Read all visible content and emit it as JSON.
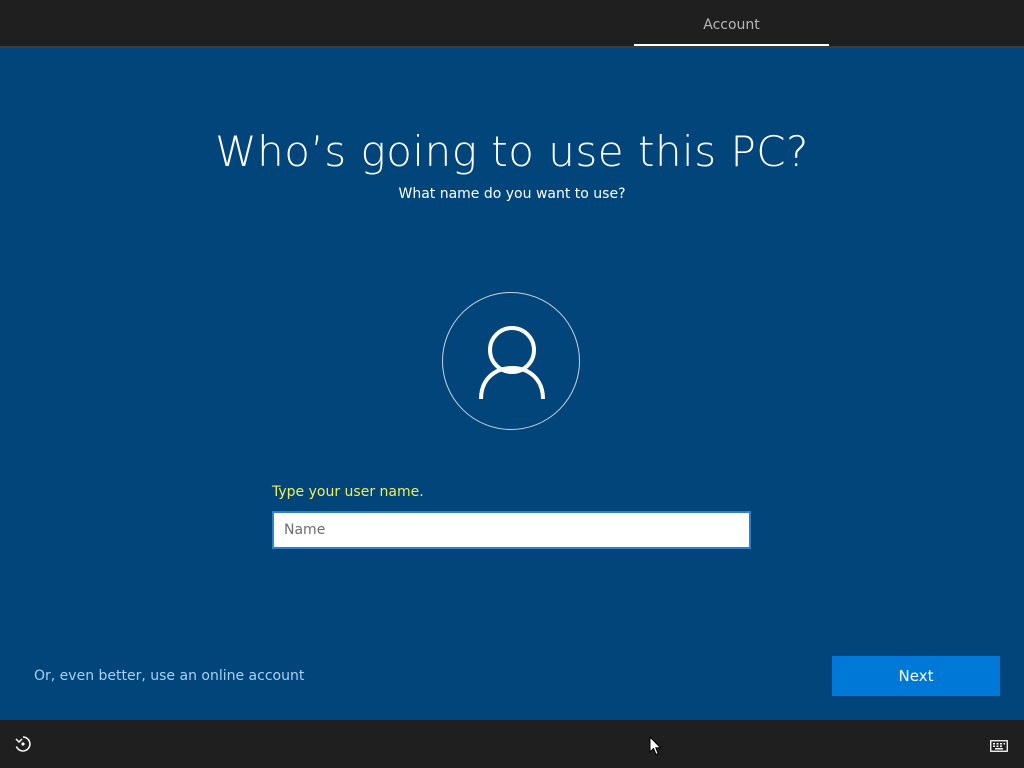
{
  "header": {
    "tab_label": "Account"
  },
  "main": {
    "title": "Who’s going to use this PC?",
    "subtitle": "What name do you want to use?",
    "name_label": "Type your user name.",
    "name_input": {
      "value": "",
      "placeholder": "Name"
    },
    "online_account_link": "Or, even better, use an online account",
    "next_button": "Next"
  },
  "footer": {
    "left_icon": "ease-of-access-icon",
    "right_icon": "keyboard-icon"
  },
  "colors": {
    "background": "#02457a",
    "bar": "#1f1f1f",
    "accent": "#0078d7",
    "label_yellow": "#f0f05a",
    "link": "#a9d0f5"
  }
}
